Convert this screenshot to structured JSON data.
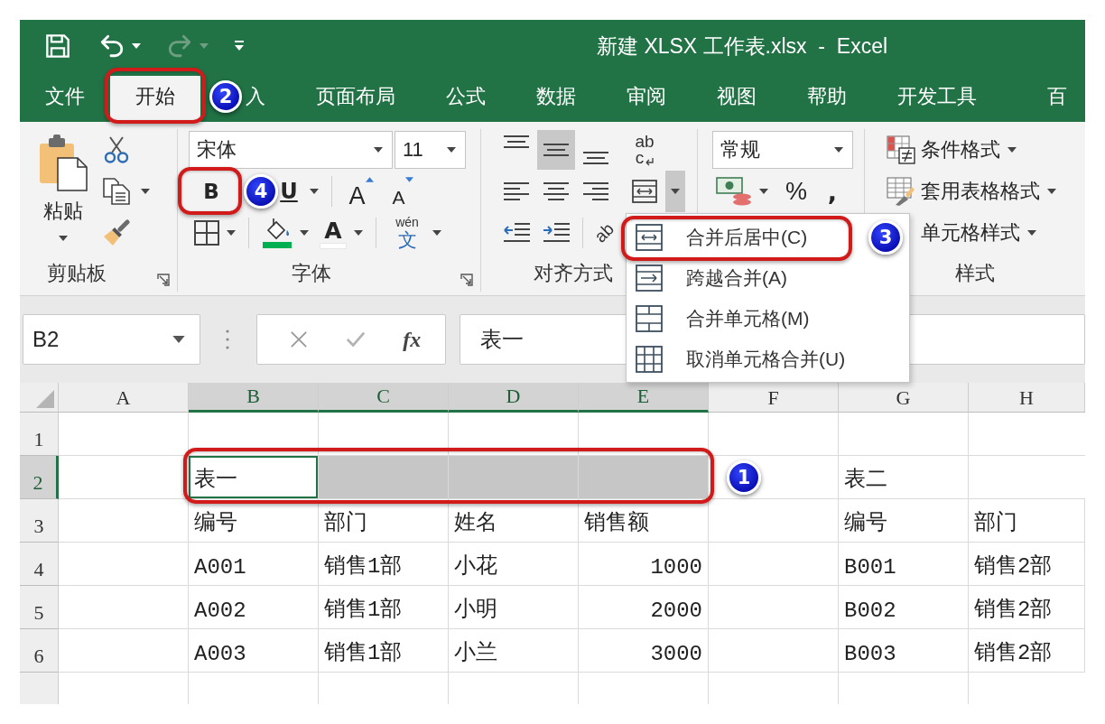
{
  "quick_access": [
    {
      "kind": "save",
      "disabled": false
    },
    {
      "kind": "undo",
      "disabled": false
    },
    {
      "kind": "redo",
      "disabled": true
    },
    {
      "kind": "customize",
      "disabled": false
    }
  ],
  "window": {
    "title": "新建 XLSX 工作表.xlsx  -  Excel"
  },
  "tabs": [
    {
      "label": "文件",
      "selected": false
    },
    {
      "label": "开始",
      "selected": true,
      "annotation": "2"
    },
    {
      "label": "入",
      "selected": false
    },
    {
      "label": "页面布局",
      "selected": false
    },
    {
      "label": "公式",
      "selected": false
    },
    {
      "label": "数据",
      "selected": false
    },
    {
      "label": "审阅",
      "selected": false
    },
    {
      "label": "视图",
      "selected": false
    },
    {
      "label": "帮助",
      "selected": false
    },
    {
      "label": "开发工具",
      "selected": false
    },
    {
      "label": "百",
      "selected": false
    }
  ],
  "clipboard": {
    "paste": "粘贴",
    "label": "剪贴板"
  },
  "font": {
    "name": "宋体",
    "size": "11",
    "bold": "B",
    "bold_annotation": "4",
    "underline": "U",
    "grow": "A",
    "shrink": "A",
    "font_color": "A",
    "phonetic_ruby": "wén",
    "phonetic": "文",
    "label": "字体"
  },
  "alignment": {
    "rows": [
      [
        {
          "kind": "align-top",
          "selected": false
        },
        {
          "kind": "align-middle",
          "selected": true
        },
        {
          "kind": "align-bottom",
          "selected": false
        },
        {
          "kind": "wrap-text",
          "selected": false,
          "text": "ab",
          "text_2": "c"
        }
      ],
      [
        {
          "kind": "align-left",
          "selected": false
        },
        {
          "kind": "align-center",
          "selected": false
        },
        {
          "kind": "align-right",
          "selected": false
        },
        {
          "kind": "merge-center",
          "selected": false
        }
      ],
      [
        {
          "kind": "decrease-indent",
          "selected": false
        },
        {
          "kind": "increase-indent",
          "selected": false
        },
        {
          "kind": "orientation",
          "selected": false,
          "text": "ab"
        }
      ]
    ],
    "label": "对齐方式"
  },
  "merge_menu": {
    "open": true,
    "items": [
      {
        "kind": "merge-center",
        "label": "合并后居中(C)",
        "annotation": "3"
      },
      {
        "kind": "merge-across",
        "label": "跨越合并(A)"
      },
      {
        "kind": "merge-cells",
        "label": "合并单元格(M)"
      },
      {
        "kind": "unmerge",
        "label": "取消单元格合并(U)"
      }
    ]
  },
  "number": {
    "format": "常规",
    "percent": "%",
    "comma": ","
  },
  "styles": {
    "items": [
      {
        "kind": "conditional",
        "label": "条件格式"
      },
      {
        "kind": "table",
        "label": "套用表格格式"
      },
      {
        "kind": "cell-styles",
        "label": "单元格样式"
      }
    ],
    "label": "样式"
  },
  "formula_bar": {
    "name_box": "B2",
    "function": "fx",
    "value": "表一"
  },
  "sheet": {
    "columns": [
      {
        "label": "A",
        "selected": false
      },
      {
        "label": "B",
        "selected": true
      },
      {
        "label": "C",
        "selected": true
      },
      {
        "label": "D",
        "selected": true
      },
      {
        "label": "E",
        "selected": true
      },
      {
        "label": "F",
        "selected": false
      },
      {
        "label": "G",
        "selected": false
      },
      {
        "label": "H",
        "selected": false
      }
    ],
    "rows": [
      {
        "label": "1",
        "selected": false
      },
      {
        "label": "2",
        "selected": true
      },
      {
        "label": "3",
        "selected": false
      },
      {
        "label": "4",
        "selected": false
      },
      {
        "label": "5",
        "selected": false
      },
      {
        "label": "6",
        "selected": false
      }
    ],
    "tables": [
      {
        "title": "表一",
        "title_selected": true,
        "title_annotation": "1",
        "headers": [
          {
            "label": "编号",
            "numeric": false
          },
          {
            "label": "部门",
            "numeric": false
          },
          {
            "label": "姓名",
            "numeric": false
          },
          {
            "label": "销售额",
            "numeric": true
          }
        ],
        "rows": [
          [
            "A001",
            "销售1部",
            "小花",
            "1000"
          ],
          [
            "A002",
            "销售1部",
            "小明",
            "2000"
          ],
          [
            "A003",
            "销售1部",
            "小兰",
            "3000"
          ]
        ]
      },
      {
        "title": "表二",
        "title_selected": false,
        "headers": [
          {
            "label": "编号",
            "numeric": false
          },
          {
            "label": "部门",
            "numeric": false
          }
        ],
        "rows": [
          [
            "B001",
            "销售2部"
          ],
          [
            "B002",
            "销售2部"
          ],
          [
            "B003",
            "销售2部"
          ]
        ]
      }
    ]
  }
}
